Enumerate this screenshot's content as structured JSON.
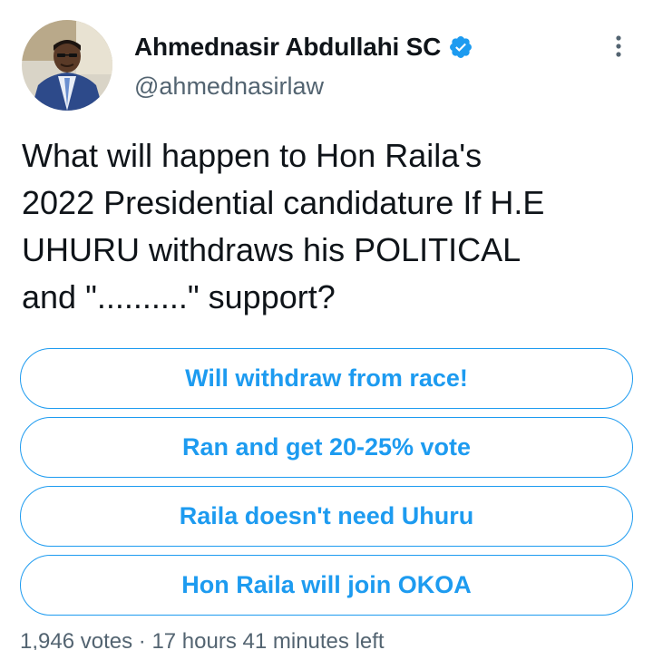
{
  "author": {
    "display_name": "Ahmednasir Abdullahi SC",
    "handle": "@ahmednasirlaw",
    "verified": true,
    "avatar_icon": "profile-photo"
  },
  "tweet": {
    "text": "What will happen to Hon Raila's\n2022 Presidential candidature If H.E\nUHURU withdraws his POLITICAL\nand \"..........\" support?"
  },
  "poll": {
    "options": [
      {
        "label": "Will withdraw from race!"
      },
      {
        "label": "Ran and get 20-25% vote"
      },
      {
        "label": "Raila doesn't need Uhuru"
      },
      {
        "label": "Hon Raila will join OKOA"
      }
    ],
    "votes": "1,946 votes",
    "separator": "·",
    "time_left": "17 hours 41 minutes left"
  },
  "colors": {
    "accent": "#1d9bf0",
    "text_primary": "#0f1419",
    "text_secondary": "#536471"
  },
  "icons": {
    "more": "more-vertical-icon",
    "verified": "verified-badge-icon"
  }
}
